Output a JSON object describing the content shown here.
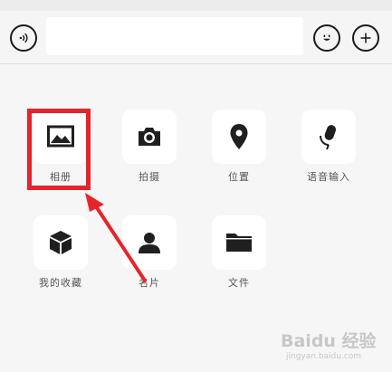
{
  "input_bar": {
    "voice_icon": "voice-wave-icon",
    "message_value": "",
    "emoji_icon": "smiley-icon",
    "plus_icon": "plus-icon"
  },
  "tools": [
    {
      "label": "相册",
      "icon": "photo-album-icon"
    },
    {
      "label": "拍摄",
      "icon": "camera-icon"
    },
    {
      "label": "位置",
      "icon": "location-pin-icon"
    },
    {
      "label": "语音输入",
      "icon": "microphone-icon"
    },
    {
      "label": "我的收藏",
      "icon": "favorites-cube-icon"
    },
    {
      "label": "名片",
      "icon": "contact-card-icon"
    },
    {
      "label": "文件",
      "icon": "folder-icon"
    }
  ],
  "annotation": {
    "color": "#e5242b",
    "target": "相册"
  },
  "watermark": {
    "logo": "Baidu 经验",
    "url": "jingyan.baidu.com"
  },
  "colors": {
    "background": "#f6f6f6",
    "tile": "#ffffff",
    "icon": "#1f1f1f",
    "label": "#555555"
  }
}
